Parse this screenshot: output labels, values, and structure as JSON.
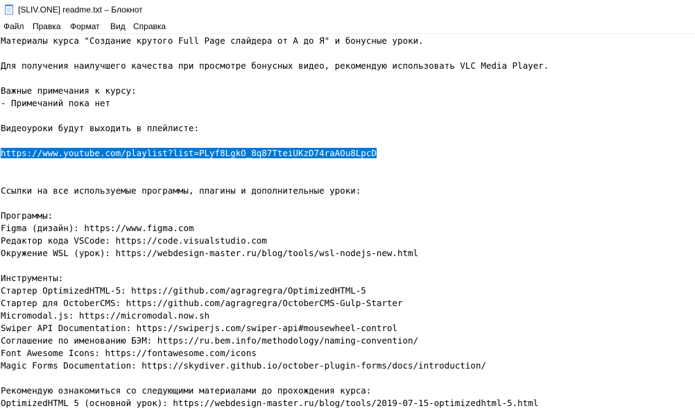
{
  "window": {
    "title": "[SLIV.ONE] readme.txt – Блокнот",
    "icon": "notepad-icon"
  },
  "menu": [
    "Файл",
    "Правка",
    "Формат",
    "Вид",
    "Справка"
  ],
  "editor": {
    "selection_color": "#0078d7",
    "lines": [
      {
        "text": "Материалы курса \"Создание крутого Full Page слайдера от А до Я\" и бонусные уроки."
      },
      {
        "text": ""
      },
      {
        "text": "Для получения наилучшего качества при просмотре бонусных видео, рекомендую использовать VLC Media Player."
      },
      {
        "text": ""
      },
      {
        "text": "Важные примечания к курсу:"
      },
      {
        "text": "- Примечаний пока нет"
      },
      {
        "text": ""
      },
      {
        "text": "Видеоуроки будут выходить в плейлисте:"
      },
      {
        "text": ""
      },
      {
        "text": "https://www.youtube.com/playlist?list=PLyf8LgkO_8q87TteiUKzD74raAOu8LpcD",
        "selected": true
      },
      {
        "text": ""
      },
      {
        "text": ""
      },
      {
        "text": "Ссылки на все используемые программы, плагины и дополнительные уроки:"
      },
      {
        "text": ""
      },
      {
        "text": "Программы:"
      },
      {
        "text": "Figma (дизайн): https://www.figma.com"
      },
      {
        "text": "Редактор кода VSCode: https://code.visualstudio.com"
      },
      {
        "text": "Окружение WSL (урок): https://webdesign-master.ru/blog/tools/wsl-nodejs-new.html"
      },
      {
        "text": ""
      },
      {
        "text": "Инструменты:"
      },
      {
        "text": "Стартер OptimizedHTML-5: https://github.com/agragregra/OptimizedHTML-5"
      },
      {
        "text": "Стартер для OctoberCMS: https://github.com/agragregra/OctoberCMS-Gulp-Starter"
      },
      {
        "text": "Micromodal.js: https://micromodal.now.sh"
      },
      {
        "text": "Swiper API Documentation: https://swiperjs.com/swiper-api#mousewheel-control"
      },
      {
        "text": "Соглашение по именованию БЭМ: https://ru.bem.info/methodology/naming-convention/"
      },
      {
        "text": "Font Awesome Icons: https://fontawesome.com/icons"
      },
      {
        "text": "Magic Forms Documentation: https://skydiver.github.io/october-plugin-forms/docs/introduction/"
      },
      {
        "text": ""
      },
      {
        "text": "Рекомендую ознакомиться со следующими материалами до прохождения курса:"
      },
      {
        "text": "OptimizedHTML 5 (основной урок): https://webdesign-master.ru/blog/tools/2019-07-15-optimizedhtml-5.html"
      }
    ]
  }
}
